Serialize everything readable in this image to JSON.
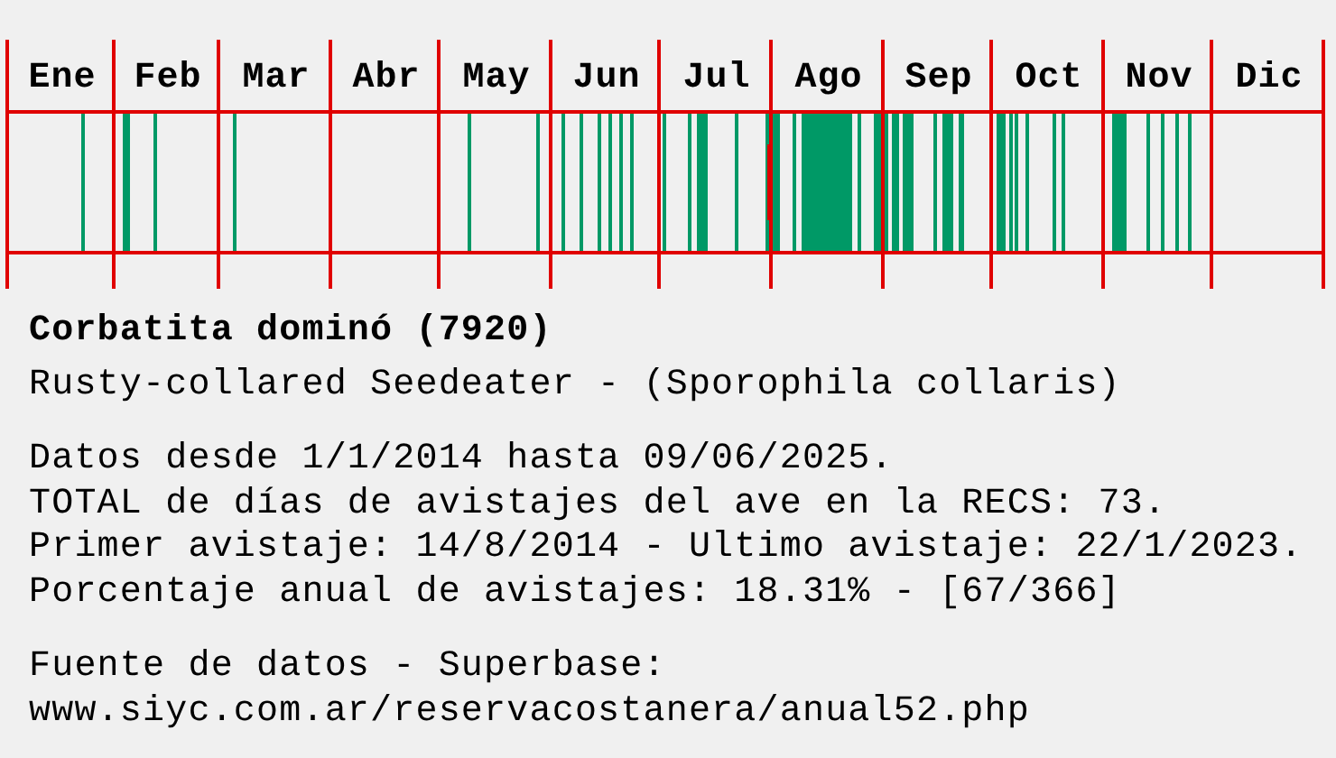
{
  "chart": {
    "months": [
      "Ene",
      "Feb",
      "Mar",
      "Abr",
      "May",
      "Jun",
      "Jul",
      "Ago",
      "Sep",
      "Oct",
      "Nov",
      "Dic"
    ]
  },
  "species": {
    "name": "Corbatita dominó (7920)",
    "subtitle": "Rusty-collared Seedeater - (Sporophila collaris)"
  },
  "stats": [
    "Datos desde 1/1/2014 hasta 09/06/2025.",
    "TOTAL de días de avistajes del ave en la RECS: 73.",
    "Primer avistaje: 14/8/2014 - Ultimo avistaje: 22/1/2023.",
    "Porcentaje anual de avistajes: 18.31% - [67/366]"
  ],
  "source": [
    "Fuente de datos - Superbase:",
    "www.siyc.com.ar/reservacostanera/anual52.php"
  ]
}
